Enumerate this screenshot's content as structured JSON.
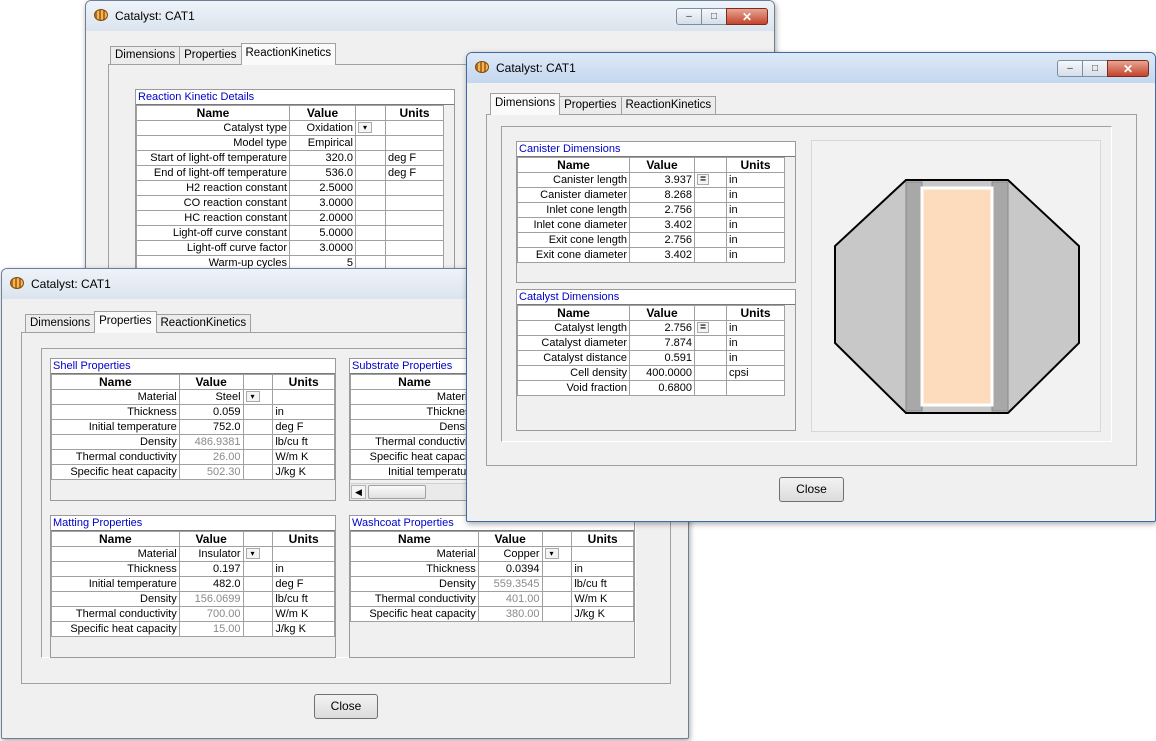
{
  "windows": {
    "back": {
      "title": "Catalyst: CAT1",
      "tabs": [
        "Dimensions",
        "Properties",
        "ReactionKinetics"
      ],
      "grid": {
        "caption": "Reaction Kinetic Details",
        "headers": [
          "Name",
          "Value",
          "",
          "Units"
        ],
        "rows": [
          {
            "name": "Catalyst type",
            "value": "Oxidation",
            "dropdown": true,
            "units": ""
          },
          {
            "name": "Model type",
            "value": "Empirical",
            "units": ""
          },
          {
            "name": "Start of light-off temperature",
            "value": "320.0",
            "units": "deg F"
          },
          {
            "name": "End of light-off temperature",
            "value": "536.0",
            "units": "deg F"
          },
          {
            "name": "H2 reaction constant",
            "value": "2.5000",
            "units": ""
          },
          {
            "name": "CO reaction constant",
            "value": "3.0000",
            "units": ""
          },
          {
            "name": "HC reaction constant",
            "value": "2.0000",
            "units": ""
          },
          {
            "name": "Light-off curve constant",
            "value": "5.0000",
            "units": ""
          },
          {
            "name": "Light-off curve factor",
            "value": "3.0000",
            "units": ""
          },
          {
            "name": "Warm-up cycles",
            "value": "5",
            "units": ""
          }
        ]
      }
    },
    "left": {
      "title": "Catalyst: CAT1",
      "tabs": [
        "Dimensions",
        "Properties",
        "ReactionKinetics"
      ],
      "shell": {
        "caption": "Shell Properties",
        "headers": [
          "Name",
          "Value",
          "",
          "Units"
        ],
        "rows": [
          {
            "name": "Material",
            "value": "Steel",
            "dropdown": true,
            "units": ""
          },
          {
            "name": "Thickness",
            "value": "0.059",
            "units": "in"
          },
          {
            "name": "Initial temperature",
            "value": "752.0",
            "units": "deg F"
          },
          {
            "name": "Density",
            "value": "486.9381",
            "gray": true,
            "units": "lb/cu ft"
          },
          {
            "name": "Thermal conductivity",
            "value": "26.00",
            "gray": true,
            "units": "W/m K"
          },
          {
            "name": "Specific heat capacity",
            "value": "502.30",
            "gray": true,
            "units": "J/kg K"
          }
        ]
      },
      "substrate": {
        "caption": "Substrate Properties",
        "headers": [
          "Name"
        ],
        "rows": [
          "Material",
          "Thickness",
          "Density",
          "Thermal conductivity",
          "Specific heat capacity",
          "Initial temperature"
        ]
      },
      "matting": {
        "caption": "Matting Properties",
        "headers": [
          "Name",
          "Value",
          "",
          "Units"
        ],
        "rows": [
          {
            "name": "Material",
            "value": "Insulator",
            "dropdown": true,
            "units": ""
          },
          {
            "name": "Thickness",
            "value": "0.197",
            "units": "in"
          },
          {
            "name": "Initial temperature",
            "value": "482.0",
            "units": "deg F"
          },
          {
            "name": "Density",
            "value": "156.0699",
            "gray": true,
            "units": "lb/cu ft"
          },
          {
            "name": "Thermal conductivity",
            "value": "700.00",
            "gray": true,
            "units": "W/m K"
          },
          {
            "name": "Specific heat capacity",
            "value": "15.00",
            "gray": true,
            "units": "J/kg K"
          }
        ]
      },
      "washcoat": {
        "caption": "Washcoat Properties",
        "headers": [
          "Name",
          "Value",
          "",
          "Units"
        ],
        "rows": [
          {
            "name": "Material",
            "value": "Copper",
            "dropdown": true,
            "units": ""
          },
          {
            "name": "Thickness",
            "value": "0.0394",
            "units": "in"
          },
          {
            "name": "Density",
            "value": "559.3545",
            "gray": true,
            "units": "lb/cu ft"
          },
          {
            "name": "Thermal conductivity",
            "value": "401.00",
            "gray": true,
            "units": "W/m K"
          },
          {
            "name": "Specific heat capacity",
            "value": "380.00",
            "gray": true,
            "units": "J/kg K"
          }
        ]
      },
      "close_label": "Close"
    },
    "right": {
      "title": "Catalyst: CAT1",
      "tabs": [
        "Dimensions",
        "Properties",
        "ReactionKinetics"
      ],
      "canister": {
        "caption": "Canister Dimensions",
        "headers": [
          "Name",
          "Value",
          "",
          "Units"
        ],
        "rows": [
          {
            "name": "Canister length",
            "value": "3.937",
            "eq": true,
            "units": "in"
          },
          {
            "name": "Canister diameter",
            "value": "8.268",
            "units": "in"
          },
          {
            "name": "Inlet cone length",
            "value": "2.756",
            "units": "in"
          },
          {
            "name": "Inlet cone diameter",
            "value": "3.402",
            "units": "in"
          },
          {
            "name": "Exit cone length",
            "value": "2.756",
            "units": "in"
          },
          {
            "name": "Exit cone diameter",
            "value": "3.402",
            "units": "in"
          }
        ]
      },
      "catalyst": {
        "caption": "Catalyst Dimensions",
        "headers": [
          "Name",
          "Value",
          "",
          "Units"
        ],
        "rows": [
          {
            "name": "Catalyst length",
            "value": "2.756",
            "eq": true,
            "units": "in"
          },
          {
            "name": "Catalyst diameter",
            "value": "7.874",
            "units": "in"
          },
          {
            "name": "Catalyst distance",
            "value": "0.591",
            "units": "in"
          },
          {
            "name": "Cell density",
            "value": "400.0000",
            "units": "cpsi"
          },
          {
            "name": "Void fraction",
            "value": "0.6800",
            "units": ""
          }
        ]
      },
      "close_label": "Close"
    }
  },
  "symbols": {
    "dropdown": "▾",
    "equals": "=",
    "scroll_left": "◀",
    "minimize": "–",
    "maximize": "□",
    "close": "✕"
  },
  "colors": {
    "caption_blue": "#0000c8",
    "substrate_fill": "#fddcbd",
    "canister_fill": "#c8c8c8"
  }
}
